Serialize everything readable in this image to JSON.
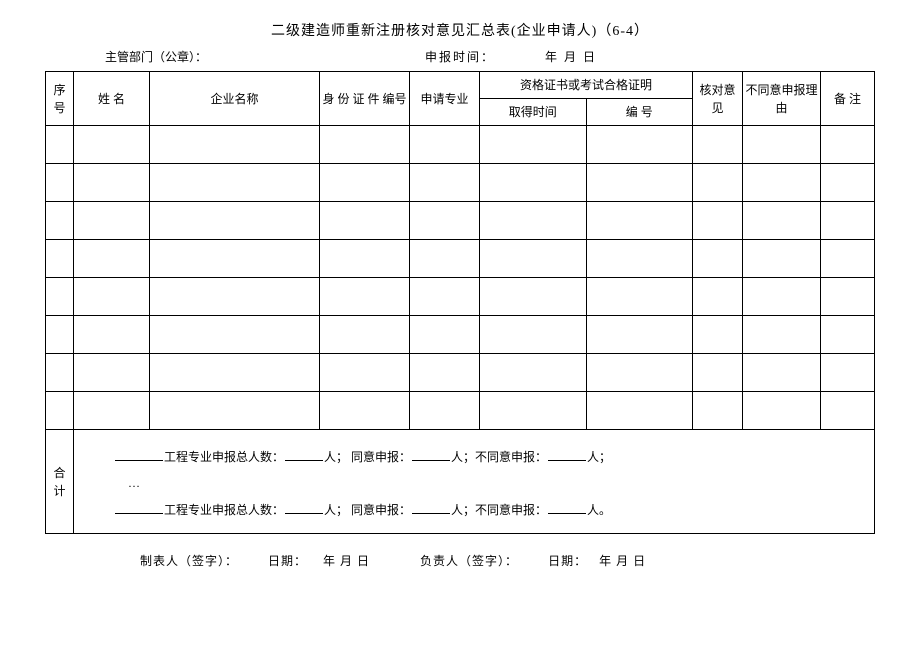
{
  "title": "二级建造师重新注册核对意见汇总表(企业申请人)（6-4）",
  "header": {
    "dept_label": "主管部门（公章）：",
    "date_label": "申报时间：",
    "date_value": "年   月   日"
  },
  "columns": {
    "seq": "序号",
    "name": "姓    名",
    "company": "企业名称",
    "id_no": "身 份 证 件 编号",
    "apply_major": "申请专业",
    "qualification_group": "资格证书或考试合格证明",
    "obtain_time": "取得时间",
    "cert_no": "编    号",
    "check_opinion": "核对意见",
    "reject_reason": "不同意申报理由",
    "remark": "备   注"
  },
  "summary": {
    "label_heji": "合计",
    "line1": {
      "t1": "工程专业申报总人数：",
      "t2": "人；  同意申报：",
      "t3": "人；不同意申报：",
      "t4": "人；"
    },
    "ellipsis": "…",
    "line2": {
      "t1": "工程专业申报总人数：",
      "t2": "人；  同意申报：",
      "t3": "人；不同意申报：",
      "t4": "人。"
    }
  },
  "footer": {
    "maker": "制表人（签字）：",
    "date_label": "日期：",
    "date_value": "年   月   日",
    "responsible": "负责人（签字）："
  }
}
